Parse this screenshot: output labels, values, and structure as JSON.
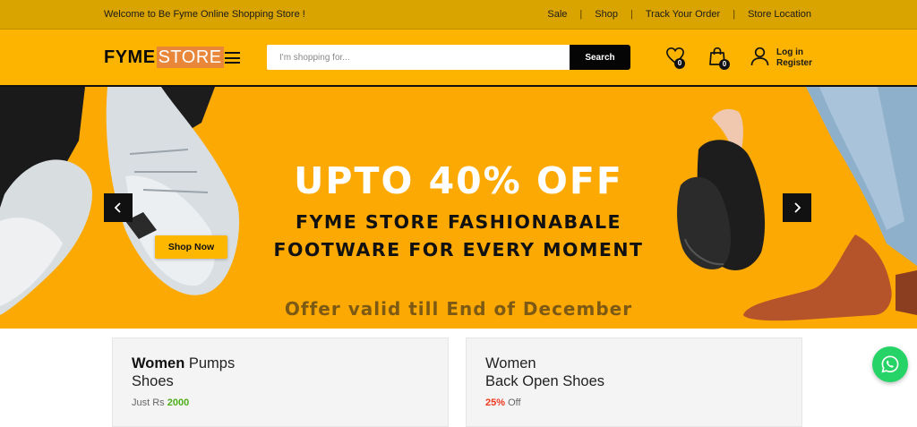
{
  "topbar": {
    "welcome": "Welcome to Be Fyme Online Shopping Store !",
    "links": [
      "Sale",
      "Shop",
      "Track Your Order",
      "Store Location"
    ]
  },
  "header": {
    "logo_part1": "FYME",
    "logo_part2": "STORE",
    "search_placeholder": "I'm shopping for...",
    "search_button": "Search",
    "wishlist_count": "0",
    "cart_count": "0",
    "login_label": "Log in",
    "register_label": "Register"
  },
  "hero": {
    "headline": "UPTO 40% OFF",
    "subline1": "FYME STORE FASHIONABALE",
    "subline2": "FOOTWARE FOR EVERY MOMENT",
    "validity": "Offer valid till End of December",
    "cta": "Shop Now"
  },
  "products": [
    {
      "title_bold": "Women",
      "title_rest": " Pumps",
      "title_line2": "Shoes",
      "price_prefix": "Just Rs ",
      "price_value": "2000"
    },
    {
      "title_bold": "",
      "title_rest": "Women",
      "title_line2": "Back Open Shoes",
      "discount": "25%",
      "discount_suffix": " Off"
    }
  ],
  "colors": {
    "topbar": "#d9a300",
    "header": "#fdb400",
    "hero": "#fca903",
    "logo_accent": "#e8873a",
    "price_green": "#4caf1a",
    "discount_red": "#f0381d",
    "whatsapp": "#25d366"
  },
  "icons": [
    "menu-icon",
    "heart-icon",
    "shopping-bag-icon",
    "user-icon",
    "chevron-left-icon",
    "chevron-right-icon",
    "whatsapp-icon"
  ]
}
